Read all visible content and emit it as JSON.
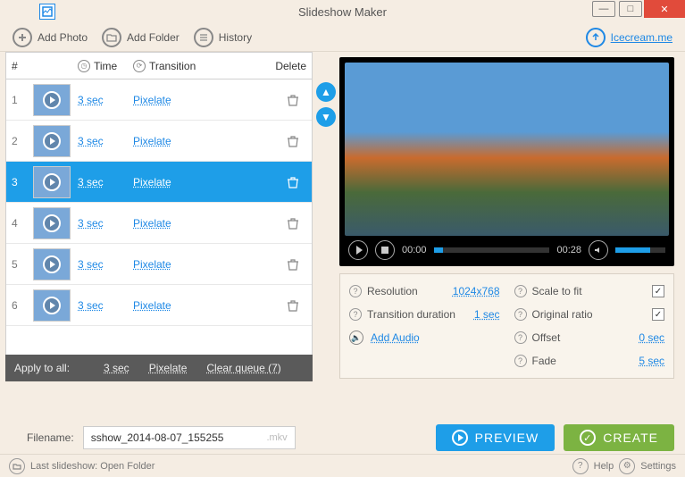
{
  "app": {
    "title": "Slideshow Maker"
  },
  "toolbar": {
    "add_photo": "Add Photo",
    "add_folder": "Add Folder",
    "history": "History",
    "brand_link": "Icecream.me"
  },
  "table": {
    "headers": {
      "num": "#",
      "time": "Time",
      "transition": "Transition",
      "delete": "Delete"
    },
    "rows": [
      {
        "num": "1",
        "time": "3 sec",
        "transition": "Pixelate",
        "selected": false
      },
      {
        "num": "2",
        "time": "3 sec",
        "transition": "Pixelate",
        "selected": false
      },
      {
        "num": "3",
        "time": "3 sec",
        "transition": "Pixelate",
        "selected": true
      },
      {
        "num": "4",
        "time": "3 sec",
        "transition": "Pixelate",
        "selected": false
      },
      {
        "num": "5",
        "time": "3 sec",
        "transition": "Pixelate",
        "selected": false
      },
      {
        "num": "6",
        "time": "3 sec",
        "transition": "Pixelate",
        "selected": false
      }
    ]
  },
  "apply_bar": {
    "label": "Apply to all:",
    "time": "3 sec",
    "transition": "Pixelate",
    "clear": "Clear queue (7)"
  },
  "player": {
    "current": "00:00",
    "total": "00:28"
  },
  "settings": {
    "resolution_label": "Resolution",
    "resolution_value": "1024x768",
    "transdur_label": "Transition duration",
    "transdur_value": "1 sec",
    "scale_label": "Scale to fit",
    "scale_checked": true,
    "ratio_label": "Original ratio",
    "ratio_checked": true,
    "offset_label": "Offset",
    "offset_value": "0 sec",
    "fade_label": "Fade",
    "fade_value": "5 sec",
    "add_audio": "Add Audio"
  },
  "filename": {
    "label": "Filename:",
    "value": "sshow_2014-08-07_155255",
    "ext": ".mkv"
  },
  "buttons": {
    "preview": "PREVIEW",
    "create": "CREATE"
  },
  "statusbar": {
    "last": "Last slideshow: Open Folder",
    "help": "Help",
    "settings": "Settings"
  }
}
